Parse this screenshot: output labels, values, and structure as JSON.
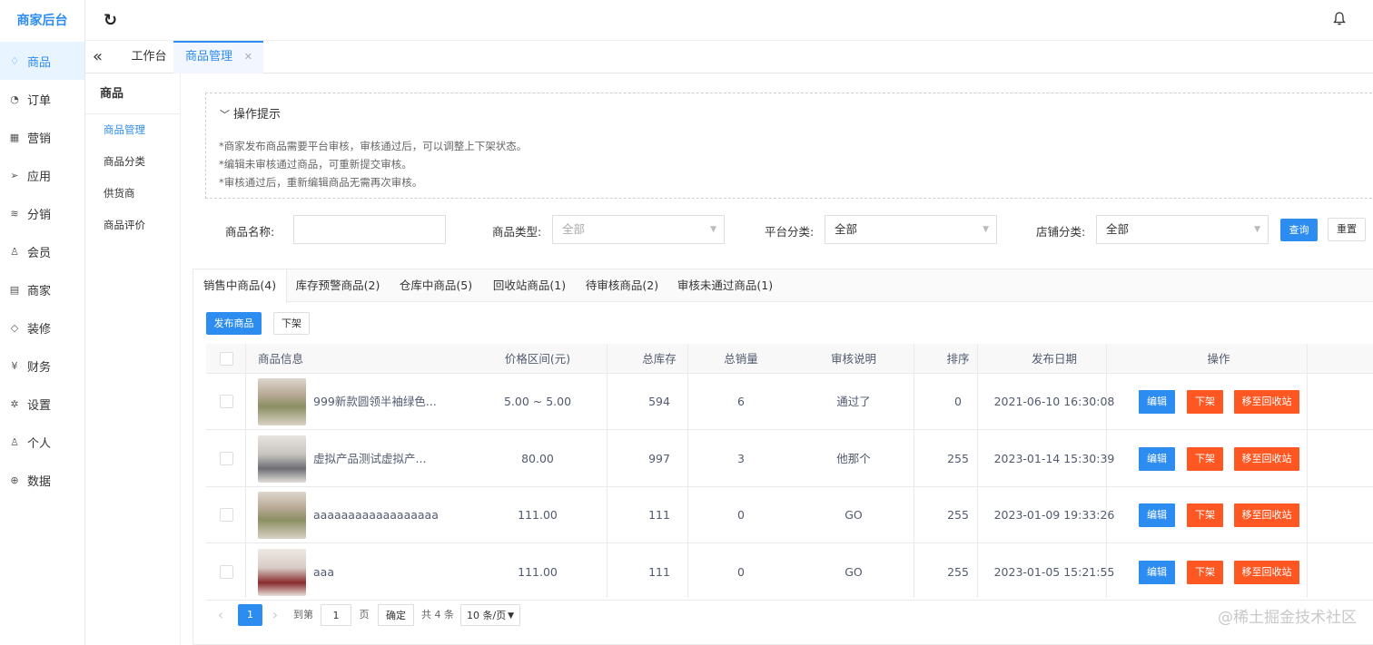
{
  "brand": "商家后台",
  "nav": [
    {
      "label": "商品",
      "icon": "diamond-icon",
      "glyph": "♢"
    },
    {
      "label": "订单",
      "icon": "bell-outline-icon",
      "glyph": "◔"
    },
    {
      "label": "营销",
      "icon": "apps-icon",
      "glyph": "▦"
    },
    {
      "label": "应用",
      "icon": "send-icon",
      "glyph": "➢"
    },
    {
      "label": "分销",
      "icon": "layers-icon",
      "glyph": "≋"
    },
    {
      "label": "会员",
      "icon": "user-icon",
      "glyph": "♙"
    },
    {
      "label": "商家",
      "icon": "shop-icon",
      "glyph": "▤"
    },
    {
      "label": "装修",
      "icon": "tag-icon",
      "glyph": "◇"
    },
    {
      "label": "财务",
      "icon": "yen-icon",
      "glyph": "¥"
    },
    {
      "label": "设置",
      "icon": "gear-icon",
      "glyph": "✲"
    },
    {
      "label": "个人",
      "icon": "person-icon",
      "glyph": "♙"
    },
    {
      "label": "数据",
      "icon": "globe-icon",
      "glyph": "⊕"
    }
  ],
  "tabs": {
    "workbench": "工作台",
    "goods_manage": "商品管理"
  },
  "sub_nav": {
    "title": "商品",
    "items": [
      "商品管理",
      "商品分类",
      "供货商",
      "商品评价"
    ]
  },
  "tips": {
    "title": "操作提示",
    "lines": [
      "*商家发布商品需要平台审核，审核通过后，可以调整上下架状态。",
      "*编辑未审核通过商品，可重新提交审核。",
      "*审核通过后，重新编辑商品无需再次审核。"
    ]
  },
  "filters": {
    "name_label": "商品名称:",
    "name_value": "",
    "type_label": "商品类型:",
    "type_value": "全部",
    "platform_label": "平台分类:",
    "platform_value": "全部",
    "store_label": "店铺分类:",
    "store_value": "全部",
    "query_btn": "查询",
    "reset_btn": "重置"
  },
  "status_tabs": [
    "销售中商品(4)",
    "库存预警商品(2)",
    "仓库中商品(5)",
    "回收站商品(1)",
    "待审核商品(2)",
    "审核未通过商品(1)"
  ],
  "actions": {
    "publish": "发布商品",
    "offline": "下架"
  },
  "table": {
    "headers": [
      "商品信息",
      "价格区间(元)",
      "总库存",
      "总销量",
      "审核说明",
      "排序",
      "发布日期",
      "操作"
    ],
    "rows": [
      {
        "name": "999新款圆领半袖绿色...",
        "price": "5.00 ~ 5.00",
        "stock": "594",
        "sales": "6",
        "note": "通过了",
        "sort": "0",
        "date": "2021-06-10 16:30:08"
      },
      {
        "name": "虚拟产品测试虚拟产...",
        "price": "80.00",
        "stock": "997",
        "sales": "3",
        "note": "他那个",
        "sort": "255",
        "date": "2023-01-14 15:30:39"
      },
      {
        "name": "aaaaaaaaaaaaaaaaaa",
        "price": "111.00",
        "stock": "111",
        "sales": "0",
        "note": "GO",
        "sort": "255",
        "date": "2023-01-09 19:33:26"
      },
      {
        "name": "aaa",
        "price": "111.00",
        "stock": "111",
        "sales": "0",
        "note": "GO",
        "sort": "255",
        "date": "2023-01-05 15:21:55"
      }
    ],
    "row_actions": {
      "edit": "编辑",
      "offline": "下架",
      "recycle": "移至回收站"
    }
  },
  "pagination": {
    "prev": "‹",
    "current": "1",
    "next": "›",
    "goto_label": "到第",
    "goto_value": "1",
    "page_unit": "页",
    "confirm": "确定",
    "total": "共 4 条",
    "page_size": "10 条/页"
  },
  "watermark": "@稀土掘金技术社区",
  "colors": {
    "primary": "#2d8cf0",
    "danger": "#ff5722"
  }
}
